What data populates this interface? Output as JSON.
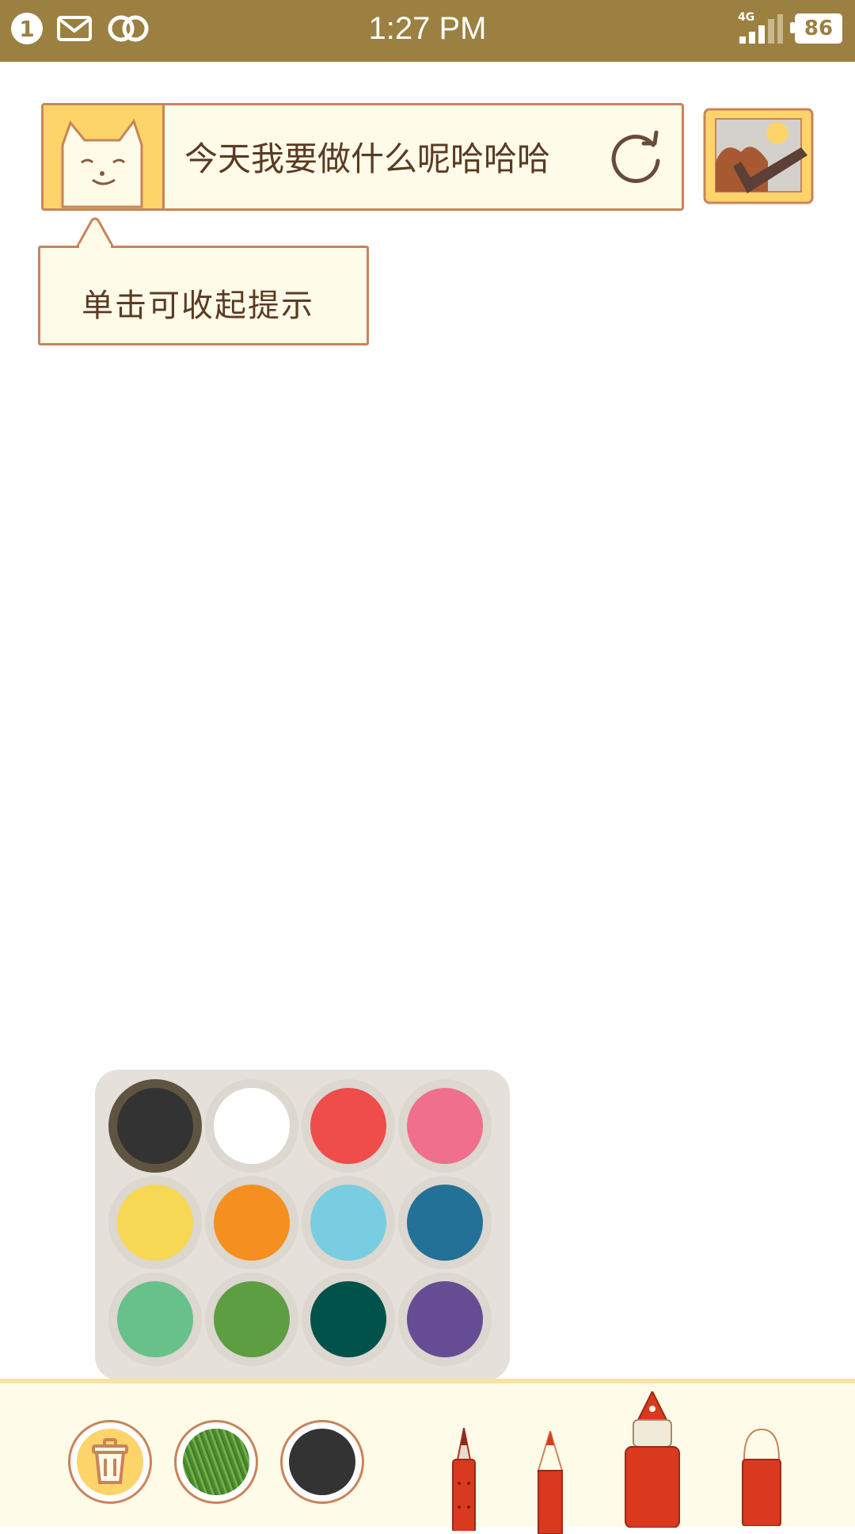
{
  "status_bar": {
    "notification_count": "1",
    "time": "1:27 PM",
    "network": "4G",
    "battery": "86",
    "icons": [
      "notification-count-icon",
      "mail-icon",
      "link-icon",
      "signal-icon",
      "battery-icon"
    ]
  },
  "prompt": {
    "text": "今天我要做什么呢哈哈哈",
    "avatar_icon": "cat-face-icon",
    "refresh_icon": "refresh-icon",
    "save_icon": "picture-frame-check-icon"
  },
  "tooltip": {
    "text": "单击可收起提示"
  },
  "palette": {
    "selected_index": 0,
    "colors": [
      "#333333",
      "#ffffff",
      "#ef4c4c",
      "#ef6f8c",
      "#f7d855",
      "#f48f20",
      "#78cee0",
      "#237197",
      "#68c18a",
      "#5e9e42",
      "#00524a",
      "#654c93"
    ]
  },
  "toolbar": {
    "trash_icon": "trash-icon",
    "texture_color": "#5a9a3a",
    "current_color": "#333333",
    "tools": [
      "pen-tool",
      "pencil-tool",
      "marker-tool",
      "eraser-tool"
    ]
  }
}
